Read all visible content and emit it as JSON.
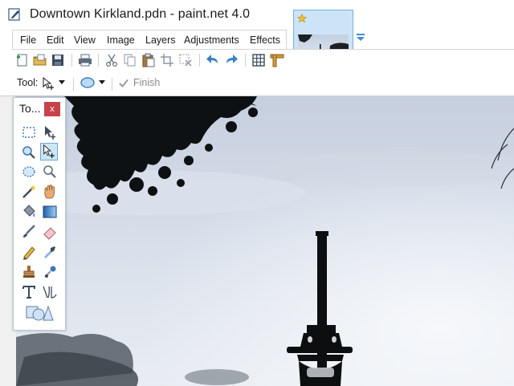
{
  "window": {
    "title": "Downtown Kirkland.pdn - paint.net 4.0"
  },
  "menu": {
    "items": [
      "File",
      "Edit",
      "View",
      "Image",
      "Layers",
      "Adjustments",
      "Effects"
    ]
  },
  "toolbar": {
    "buttons": [
      "new-icon",
      "open-icon",
      "save-icon",
      "print-icon",
      "cut-icon",
      "copy-icon",
      "paste-icon",
      "crop-icon",
      "deselect-icon",
      "undo-icon",
      "redo-icon",
      "grid-icon",
      "ruler-icon"
    ]
  },
  "toolrow": {
    "tool_label": "Tool:",
    "finish_label": "Finish"
  },
  "tools_window": {
    "title": "To...",
    "close_label": "x",
    "tools": [
      "rectangle-select",
      "move-selected-pixels",
      "zoom",
      "move-selection",
      "ellipse-select",
      "zoom-magnifier",
      "magic-wand",
      "pan",
      "paint-bucket",
      "gradient",
      "paintbrush",
      "eraser",
      "pencil",
      "color-picker",
      "clone-stamp",
      "recolor",
      "text",
      "line-curve",
      "shapes"
    ]
  },
  "thumbnail": {
    "favorite": "star-icon"
  },
  "colors": {
    "accent": "#cce4f7",
    "close_red": "#c7424b",
    "sky_top": "#c8d1e0",
    "sky_bottom": "#e6ebf3"
  }
}
